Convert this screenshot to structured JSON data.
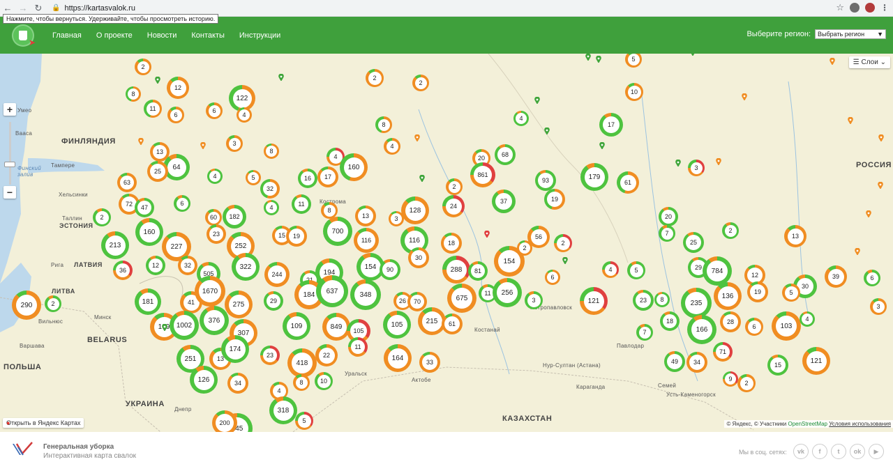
{
  "browser": {
    "url": "https://kartasvalok.ru",
    "back_tooltip": "Нажмите, чтобы вернуться. Удерживайте, чтобы просмотреть историю."
  },
  "header": {
    "nav": [
      "Главная",
      "О проекте",
      "Новости",
      "Контакты",
      "Инструкции"
    ],
    "region_label": "Выберите регион:",
    "region_selected": "Выбрать регион"
  },
  "map": {
    "layers_label": "Слои",
    "open_yandex": "Открыть в Яндекс Картах",
    "copyright_prefix": "© Яндекс, © Участники",
    "copyright_osm": "OpenStreetMap",
    "copyright_terms": "Условия использования",
    "labels": {
      "finland": "ФИНЛЯНДИЯ",
      "russia": "РОССИЯ",
      "estonia": "ЭСТОНИЯ",
      "latvia": "ЛАТВИЯ",
      "lithuania": "ЛИТВА",
      "belarus": "BELARUS",
      "poland": "ПОЛЬША",
      "ukraine": "УКРАИНА",
      "kazakhstan": "КАЗАХСТАН",
      "gulf": "Финский залив"
    },
    "cities": [
      {
        "name": "Умео"
      },
      {
        "name": "Вааса"
      },
      {
        "name": "Тампере"
      },
      {
        "name": "Хельсинки"
      },
      {
        "name": "Таллин"
      },
      {
        "name": "Рига"
      },
      {
        "name": "Вильнюс"
      },
      {
        "name": "Минск"
      },
      {
        "name": "Варшава"
      },
      {
        "name": "Днепр"
      },
      {
        "name": "Кострома"
      },
      {
        "name": "Костанай"
      },
      {
        "name": "Павлодар"
      },
      {
        "name": "Нур-Султан (Астана)"
      },
      {
        "name": "Караганда"
      },
      {
        "name": "Семей"
      },
      {
        "name": "Усть-Каменогорск"
      },
      {
        "name": "Актобе"
      },
      {
        "name": "Уральск"
      },
      {
        "name": "Петропавловск"
      }
    ],
    "clusters": [
      {
        "label": "2",
        "ring": "orange"
      },
      {
        "label": "12",
        "ring": "orange"
      },
      {
        "label": "8",
        "ring": "mix"
      },
      {
        "label": "11",
        "ring": "mix"
      },
      {
        "label": "6",
        "ring": "orange"
      },
      {
        "label": "122",
        "ring": "mix"
      },
      {
        "label": "6",
        "ring": "orange"
      },
      {
        "label": "4",
        "ring": "orange"
      },
      {
        "label": "2",
        "ring": "orange"
      },
      {
        "label": "2",
        "ring": "orange"
      },
      {
        "label": "5",
        "ring": "orange"
      },
      {
        "label": "10",
        "ring": "orange"
      },
      {
        "label": "8",
        "ring": "mix"
      },
      {
        "label": "4",
        "ring": "green"
      },
      {
        "label": "17",
        "ring": "green"
      },
      {
        "label": "3",
        "ring": "orange"
      },
      {
        "label": "8",
        "ring": "orange"
      },
      {
        "label": "4",
        "ring": "orange"
      },
      {
        "label": "13",
        "ring": "orange"
      },
      {
        "label": "64",
        "ring": "green"
      },
      {
        "label": "25",
        "ring": "orange"
      },
      {
        "label": "4",
        "ring": "green"
      },
      {
        "label": "5",
        "ring": "orange"
      },
      {
        "label": "32",
        "ring": "mix"
      },
      {
        "label": "16",
        "ring": "green"
      },
      {
        "label": "17",
        "ring": "orange"
      },
      {
        "label": "4",
        "ring": "red"
      },
      {
        "label": "160",
        "ring": "mix"
      },
      {
        "label": "20",
        "ring": "orange"
      },
      {
        "label": "68",
        "ring": "green"
      },
      {
        "label": "861",
        "ring": "red"
      },
      {
        "label": "2",
        "ring": "orange"
      },
      {
        "label": "93",
        "ring": "green"
      },
      {
        "label": "179",
        "ring": "green"
      },
      {
        "label": "61",
        "ring": "mix"
      },
      {
        "label": "3",
        "ring": "red"
      },
      {
        "label": "63",
        "ring": "orange"
      },
      {
        "label": "72",
        "ring": "orange"
      },
      {
        "label": "47",
        "ring": "green"
      },
      {
        "label": "6",
        "ring": "green"
      },
      {
        "label": "2",
        "ring": "green"
      },
      {
        "label": "160",
        "ring": "green"
      },
      {
        "label": "213",
        "ring": "green"
      },
      {
        "label": "12",
        "ring": "green"
      },
      {
        "label": "227",
        "ring": "orange"
      },
      {
        "label": "36",
        "ring": "red"
      },
      {
        "label": "60",
        "ring": "orange"
      },
      {
        "label": "182",
        "ring": "green"
      },
      {
        "label": "23",
        "ring": "orange"
      },
      {
        "label": "252",
        "ring": "orange"
      },
      {
        "label": "4",
        "ring": "green"
      },
      {
        "label": "11",
        "ring": "green"
      },
      {
        "label": "8",
        "ring": "orange"
      },
      {
        "label": "13",
        "ring": "orange"
      },
      {
        "label": "128",
        "ring": "orange"
      },
      {
        "label": "24",
        "ring": "red"
      },
      {
        "label": "37",
        "ring": "green"
      },
      {
        "label": "19",
        "ring": "mix"
      },
      {
        "label": "15",
        "ring": "orange"
      },
      {
        "label": "19",
        "ring": "orange"
      },
      {
        "label": "700",
        "ring": "green"
      },
      {
        "label": "116",
        "ring": "orange"
      },
      {
        "label": "3",
        "ring": "orange"
      },
      {
        "label": "116",
        "ring": "green"
      },
      {
        "label": "18",
        "ring": "orange"
      },
      {
        "label": "56",
        "ring": "orange"
      },
      {
        "label": "2",
        "ring": "red"
      },
      {
        "label": "20",
        "ring": "green"
      },
      {
        "label": "2",
        "ring": "green"
      },
      {
        "label": "7",
        "ring": "green"
      },
      {
        "label": "13",
        "ring": "orange"
      },
      {
        "label": "25",
        "ring": "green"
      },
      {
        "label": "32",
        "ring": "orange"
      },
      {
        "label": "505",
        "ring": "green"
      },
      {
        "label": "322",
        "ring": "green"
      },
      {
        "label": "244",
        "ring": "orange"
      },
      {
        "label": "21",
        "ring": "green"
      },
      {
        "label": "194",
        "ring": "green"
      },
      {
        "label": "154",
        "ring": "green"
      },
      {
        "label": "90",
        "ring": "green"
      },
      {
        "label": "30",
        "ring": "orange"
      },
      {
        "label": "288",
        "ring": "red"
      },
      {
        "label": "81",
        "ring": "green"
      },
      {
        "label": "154",
        "ring": "orange"
      },
      {
        "label": "2",
        "ring": "orange"
      },
      {
        "label": "6",
        "ring": "orange"
      },
      {
        "label": "4",
        "ring": "red"
      },
      {
        "label": "5",
        "ring": "green"
      },
      {
        "label": "29",
        "ring": "green"
      },
      {
        "label": "784",
        "ring": "green"
      },
      {
        "label": "12",
        "ring": "orange"
      },
      {
        "label": "30",
        "ring": "green"
      },
      {
        "label": "39",
        "ring": "orange"
      },
      {
        "label": "6",
        "ring": "green"
      },
      {
        "label": "290",
        "ring": "orange"
      },
      {
        "label": "2",
        "ring": "green"
      },
      {
        "label": "181",
        "ring": "green"
      },
      {
        "label": "41",
        "ring": "orange"
      },
      {
        "label": "1670",
        "ring": "orange"
      },
      {
        "label": "275",
        "ring": "orange"
      },
      {
        "label": "29",
        "ring": "green"
      },
      {
        "label": "184",
        "ring": "orange"
      },
      {
        "label": "637",
        "ring": "green"
      },
      {
        "label": "348",
        "ring": "green"
      },
      {
        "label": "26",
        "ring": "orange"
      },
      {
        "label": "70",
        "ring": "orange"
      },
      {
        "label": "675",
        "ring": "orange"
      },
      {
        "label": "11",
        "ring": "green"
      },
      {
        "label": "256",
        "ring": "green"
      },
      {
        "label": "3",
        "ring": "green"
      },
      {
        "label": "121",
        "ring": "red"
      },
      {
        "label": "23",
        "ring": "green"
      },
      {
        "label": "8",
        "ring": "green"
      },
      {
        "label": "235",
        "ring": "green"
      },
      {
        "label": "136",
        "ring": "orange"
      },
      {
        "label": "19",
        "ring": "orange"
      },
      {
        "label": "5",
        "ring": "orange"
      },
      {
        "label": "3",
        "ring": "orange"
      },
      {
        "label": "199",
        "ring": "orange"
      },
      {
        "label": "1002",
        "ring": "green"
      },
      {
        "label": "376",
        "ring": "green"
      },
      {
        "label": "307",
        "ring": "orange"
      },
      {
        "label": "109",
        "ring": "green"
      },
      {
        "label": "849",
        "ring": "orange"
      },
      {
        "label": "105",
        "ring": "red"
      },
      {
        "label": "105",
        "ring": "green"
      },
      {
        "label": "215",
        "ring": "orange"
      },
      {
        "label": "61",
        "ring": "orange"
      },
      {
        "label": "18",
        "ring": "green"
      },
      {
        "label": "166",
        "ring": "green"
      },
      {
        "label": "28",
        "ring": "orange"
      },
      {
        "label": "6",
        "ring": "orange"
      },
      {
        "label": "103",
        "ring": "orange"
      },
      {
        "label": "4",
        "ring": "green"
      },
      {
        "label": "7",
        "ring": "green"
      },
      {
        "label": "251",
        "ring": "green"
      },
      {
        "label": "13",
        "ring": "orange"
      },
      {
        "label": "174",
        "ring": "green"
      },
      {
        "label": "23",
        "ring": "red"
      },
      {
        "label": "22",
        "ring": "orange"
      },
      {
        "label": "11",
        "ring": "red"
      },
      {
        "label": "164",
        "ring": "orange"
      },
      {
        "label": "33",
        "ring": "orange"
      },
      {
        "label": "71",
        "ring": "red"
      },
      {
        "label": "126",
        "ring": "green"
      },
      {
        "label": "34",
        "ring": "orange"
      },
      {
        "label": "418",
        "ring": "orange"
      },
      {
        "label": "8",
        "ring": "orange"
      },
      {
        "label": "10",
        "ring": "green"
      },
      {
        "label": "49",
        "ring": "green"
      },
      {
        "label": "34",
        "ring": "orange"
      },
      {
        "label": "9",
        "ring": "red"
      },
      {
        "label": "2",
        "ring": "orange"
      },
      {
        "label": "15",
        "ring": "green"
      },
      {
        "label": "121",
        "ring": "orange"
      },
      {
        "label": "4",
        "ring": "orange"
      },
      {
        "label": "318",
        "ring": "green"
      },
      {
        "label": "5",
        "ring": "red"
      },
      {
        "label": "245",
        "ring": "green"
      },
      {
        "label": "200",
        "ring": "orange"
      }
    ]
  },
  "footer": {
    "title": "Генеральная уборка",
    "subtitle": "Интерактивная карта свалок",
    "social_label": "Мы в соц. сетях:",
    "socials": [
      "vk-icon",
      "facebook-icon",
      "twitter-icon",
      "odnoklassniki-icon",
      "youtube-icon"
    ]
  },
  "colors": {
    "header": "#3fa03c",
    "green": "#4ec33f",
    "orange": "#f08d22",
    "red": "#e04040",
    "map_land": "#f3f0d9",
    "map_water": "#bdd8ec"
  }
}
